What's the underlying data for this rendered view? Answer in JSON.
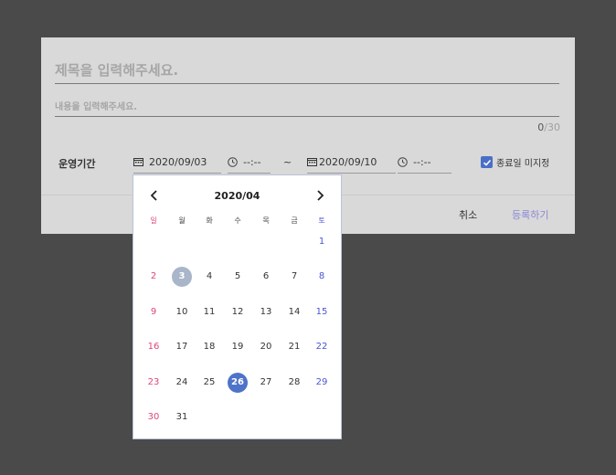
{
  "form": {
    "title_placeholder": "제목을 입력해주세요.",
    "content_placeholder": "내용을 입력해주세요.",
    "char_count_current": "0",
    "char_count_max": "/30",
    "period_label": "운영기간",
    "start_date": "2020/09/03",
    "start_time": "--:--",
    "separator": "~",
    "end_date": "2020/09/10",
    "end_time": "--:--",
    "no_end_date_label": "종료일 미지정",
    "no_end_date_checked": true
  },
  "footer": {
    "cancel_label": "취소",
    "submit_label": "등록하기"
  },
  "calendar": {
    "month_label": "2020/04",
    "weekdays": [
      "일",
      "월",
      "화",
      "수",
      "목",
      "금",
      "토"
    ],
    "days": [
      [
        "",
        "",
        "",
        "",
        "",
        "",
        "1"
      ],
      [
        "2",
        "3",
        "4",
        "5",
        "6",
        "7",
        "8"
      ],
      [
        "9",
        "10",
        "11",
        "12",
        "13",
        "14",
        "15"
      ],
      [
        "16",
        "17",
        "18",
        "19",
        "20",
        "21",
        "22"
      ],
      [
        "23",
        "24",
        "25",
        "26",
        "27",
        "28",
        "29"
      ],
      [
        "30",
        "31",
        "",
        "",
        "",
        "",
        ""
      ]
    ],
    "today": "3",
    "selected": "26"
  },
  "colors": {
    "sunday": "#e0457b",
    "saturday": "#4a55d0",
    "selected": "#4e73c9",
    "today": "#a9b5c9",
    "submit": "#8b87d6"
  }
}
